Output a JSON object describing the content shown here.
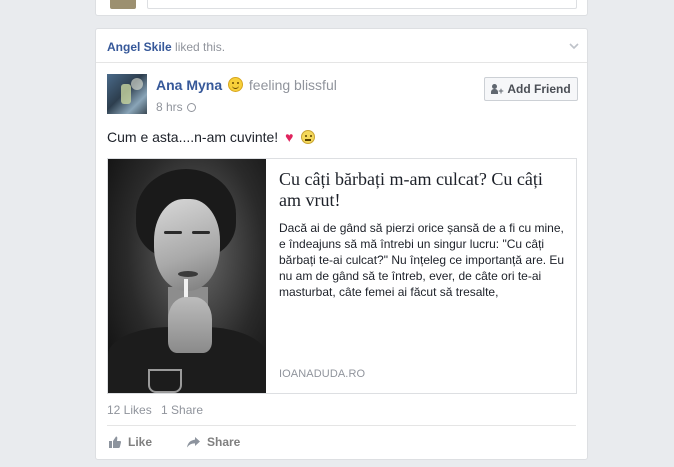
{
  "story": {
    "liker_name": "Angel Skile",
    "liker_suffix": " liked this."
  },
  "post": {
    "author_name": "Ana Myna",
    "feeling": "feeling blissful",
    "time": "8 hrs",
    "add_friend_label": "Add Friend",
    "text": "Cum e asta....n-am cuvinte!"
  },
  "link_preview": {
    "title": "Cu câți bărbați m-am culcat? Cu câți am vrut!",
    "description": "Dacă ai de gând să pierzi orice șansă de a fi cu mine, e îndeajuns să mă întrebi un singur lucru: \"Cu câți bărbați te-ai culcat?\" Nu înțeleg ce importanță are. Eu nu am de gând să te întreb, ever, de câte ori te-ai masturbat, câte femei ai făcut să tresalte,",
    "domain": "IOANADUDA.RO"
  },
  "stats": {
    "likes": "12 Likes",
    "shares": "1 Share"
  },
  "actions": {
    "like_label": "Like",
    "share_label": "Share"
  },
  "colors": {
    "link_blue": "#365899",
    "meta_grey": "#90949c",
    "heart_red": "#e0245e"
  },
  "icons": [
    "chevron-down-icon",
    "smiley-icon",
    "globe-icon",
    "add-friend-icon",
    "heart-icon",
    "neutral-face-icon",
    "thumbs-up-icon",
    "share-arrow-icon"
  ]
}
